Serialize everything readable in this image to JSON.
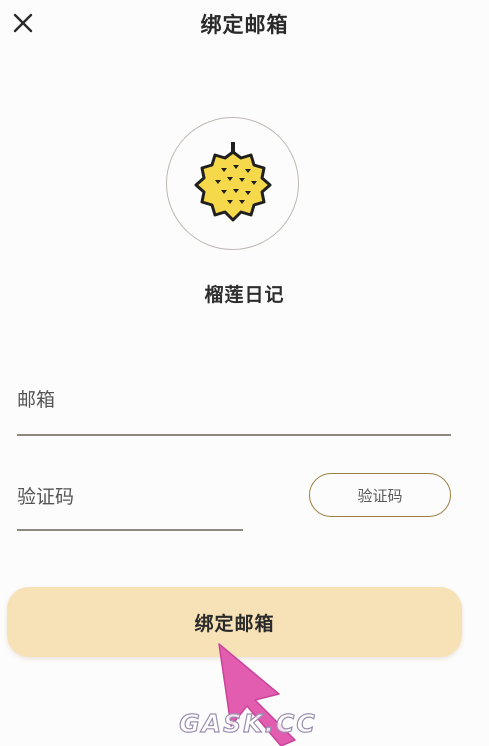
{
  "header": {
    "close_icon": "close-icon",
    "title": "绑定邮箱"
  },
  "app": {
    "logo_icon": "durian-icon",
    "name": "榴莲日记",
    "accent_color": "#f5d94a"
  },
  "form": {
    "email_placeholder": "邮箱",
    "email_value": "",
    "code_placeholder": "验证码",
    "code_value": "",
    "code_button_label": "验证码"
  },
  "submit": {
    "label": "绑定邮箱",
    "background_color": "#f7e2b8"
  },
  "watermark": {
    "text": "GASK.CC"
  },
  "overlay": {
    "arrow_color": "#e25cb0"
  }
}
